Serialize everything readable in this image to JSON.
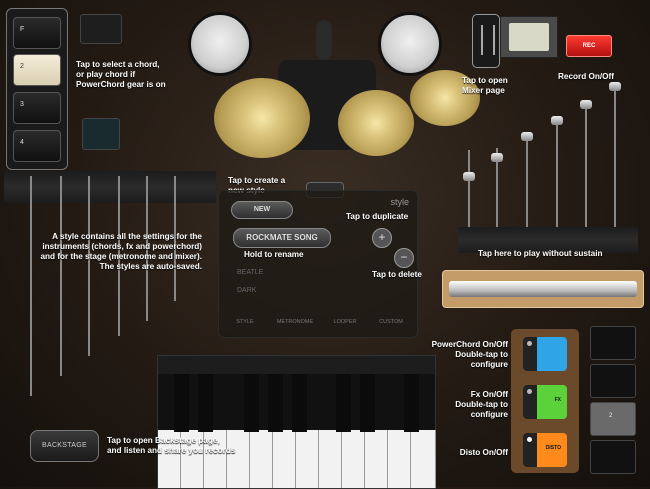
{
  "chord_panel": {
    "buttons": [
      {
        "label": "F",
        "selected": false
      },
      {
        "label": "2",
        "selected": true
      },
      {
        "label": "3",
        "selected": false
      },
      {
        "label": "4",
        "selected": false
      }
    ]
  },
  "hints": {
    "select_chord": "Tap to select a chord,\nor play chord if\nPowerChord gear is on",
    "open_mixer": "Tap to open\nMixer page",
    "record": "Record On/Off",
    "create_style": "Tap to create a\nnew style",
    "duplicate": "Tap to duplicate",
    "rename": "Hold to rename",
    "delete": "Tap to delete",
    "style_info": "A style contains all the settings for the\ninstruments (chords, fx and powerchord)\nand for the stage (metronome and mixer).\nThe styles are auto-saved.",
    "play_without_sustain": "Tap here to play without sustain",
    "powerchord": "PowerChord On/Off\nDouble-tap to\nconfigure",
    "fx": "Fx On/Off\nDouble-tap to\nconfigure",
    "disto": "Disto On/Off",
    "backstage": "Tap to open Backstage page,\nand listen and share you records"
  },
  "style_panel": {
    "header": "style",
    "new_label": "NEW",
    "current_style": "ROCKMATE SONG",
    "list_items": [
      "BEATLE",
      "DARK"
    ],
    "tabs": [
      "STYLE",
      "METRONOME",
      "LOOPER",
      "CUSTOM"
    ],
    "duplicate_icon": "plus-icon",
    "delete_icon": "minus-icon"
  },
  "record_button": {
    "label": "REC",
    "color": "#e0231b"
  },
  "backstage_button": {
    "label": "BACKSTAGE"
  },
  "pedals": [
    {
      "name": "powerchord",
      "color": "#2fa4e7",
      "label": ""
    },
    {
      "name": "fx",
      "color": "#5bd13a",
      "label": "FX"
    },
    {
      "name": "disto",
      "color": "#ff8a1c",
      "label": "DISTO"
    }
  ],
  "side_buttons": [
    {
      "label": "",
      "light": false
    },
    {
      "label": "",
      "light": false
    },
    {
      "label": "2",
      "light": true
    },
    {
      "label": "",
      "light": false
    }
  ]
}
